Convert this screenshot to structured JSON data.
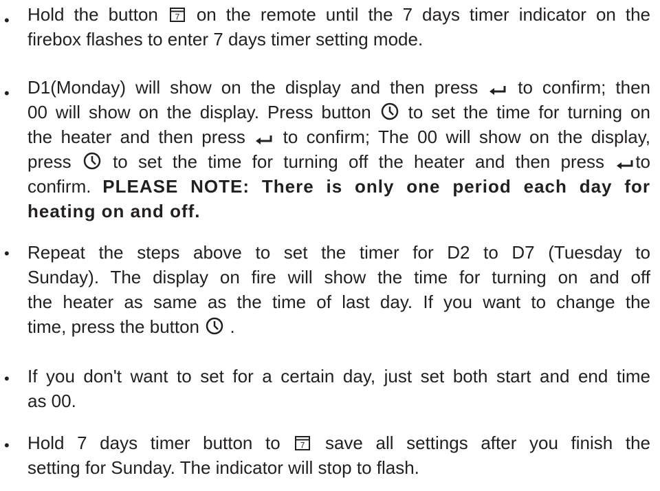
{
  "bullets": [
    {
      "lines": [
        {
          "a": "Hold the button ",
          "b": " on the remote until the 7 days timer indicator on the"
        },
        {
          "a": "firebox flashes to enter 7 days timer setting mode."
        }
      ]
    },
    {
      "lines": [
        {
          "a": "D1(Monday) will show on the display and then press ",
          "b": " to confirm; then"
        },
        {
          "a": "00 will show on the display. Press button ",
          "b": " to set the time for turning on"
        },
        {
          "a": "the heater and then press ",
          "b": " to confirm; The 00 will show on the display,"
        },
        {
          "a": "press ",
          "b": " to set the time for turning off the heater and then press ",
          "c": "to"
        },
        {
          "a": "confirm. ",
          "bold": "PLEASE NOTE: There is only one period each day for"
        },
        {
          "bold": "heating on and off."
        }
      ]
    },
    {
      "lines": [
        {
          "a": "Repeat the steps above to set the timer for D2 to D7 (Tuesday to"
        },
        {
          "a": "Sunday). The display on fire will show the time for turning on and off"
        },
        {
          "a": "the heater as same as the time of last day. If you want to change the"
        },
        {
          "a": "time, press the button ",
          "b": " ."
        }
      ]
    },
    {
      "lines": [
        {
          "a": "If you don't want to set for a certain day, just set both start and end time"
        },
        {
          "a": "as 00."
        }
      ]
    },
    {
      "lines": [
        {
          "a": "Hold 7 days timer button   to ",
          "b": " save all settings after you finish the"
        },
        {
          "a": "setting for Sunday. The indicator will stop to flash."
        }
      ]
    }
  ],
  "icons": {
    "calendar": "calendar-7-icon",
    "enter": "enter-arrow-icon",
    "clock": "clock-icon",
    "calendar_day": "7"
  },
  "bullet_char": "•",
  "text_color": "#231f20"
}
